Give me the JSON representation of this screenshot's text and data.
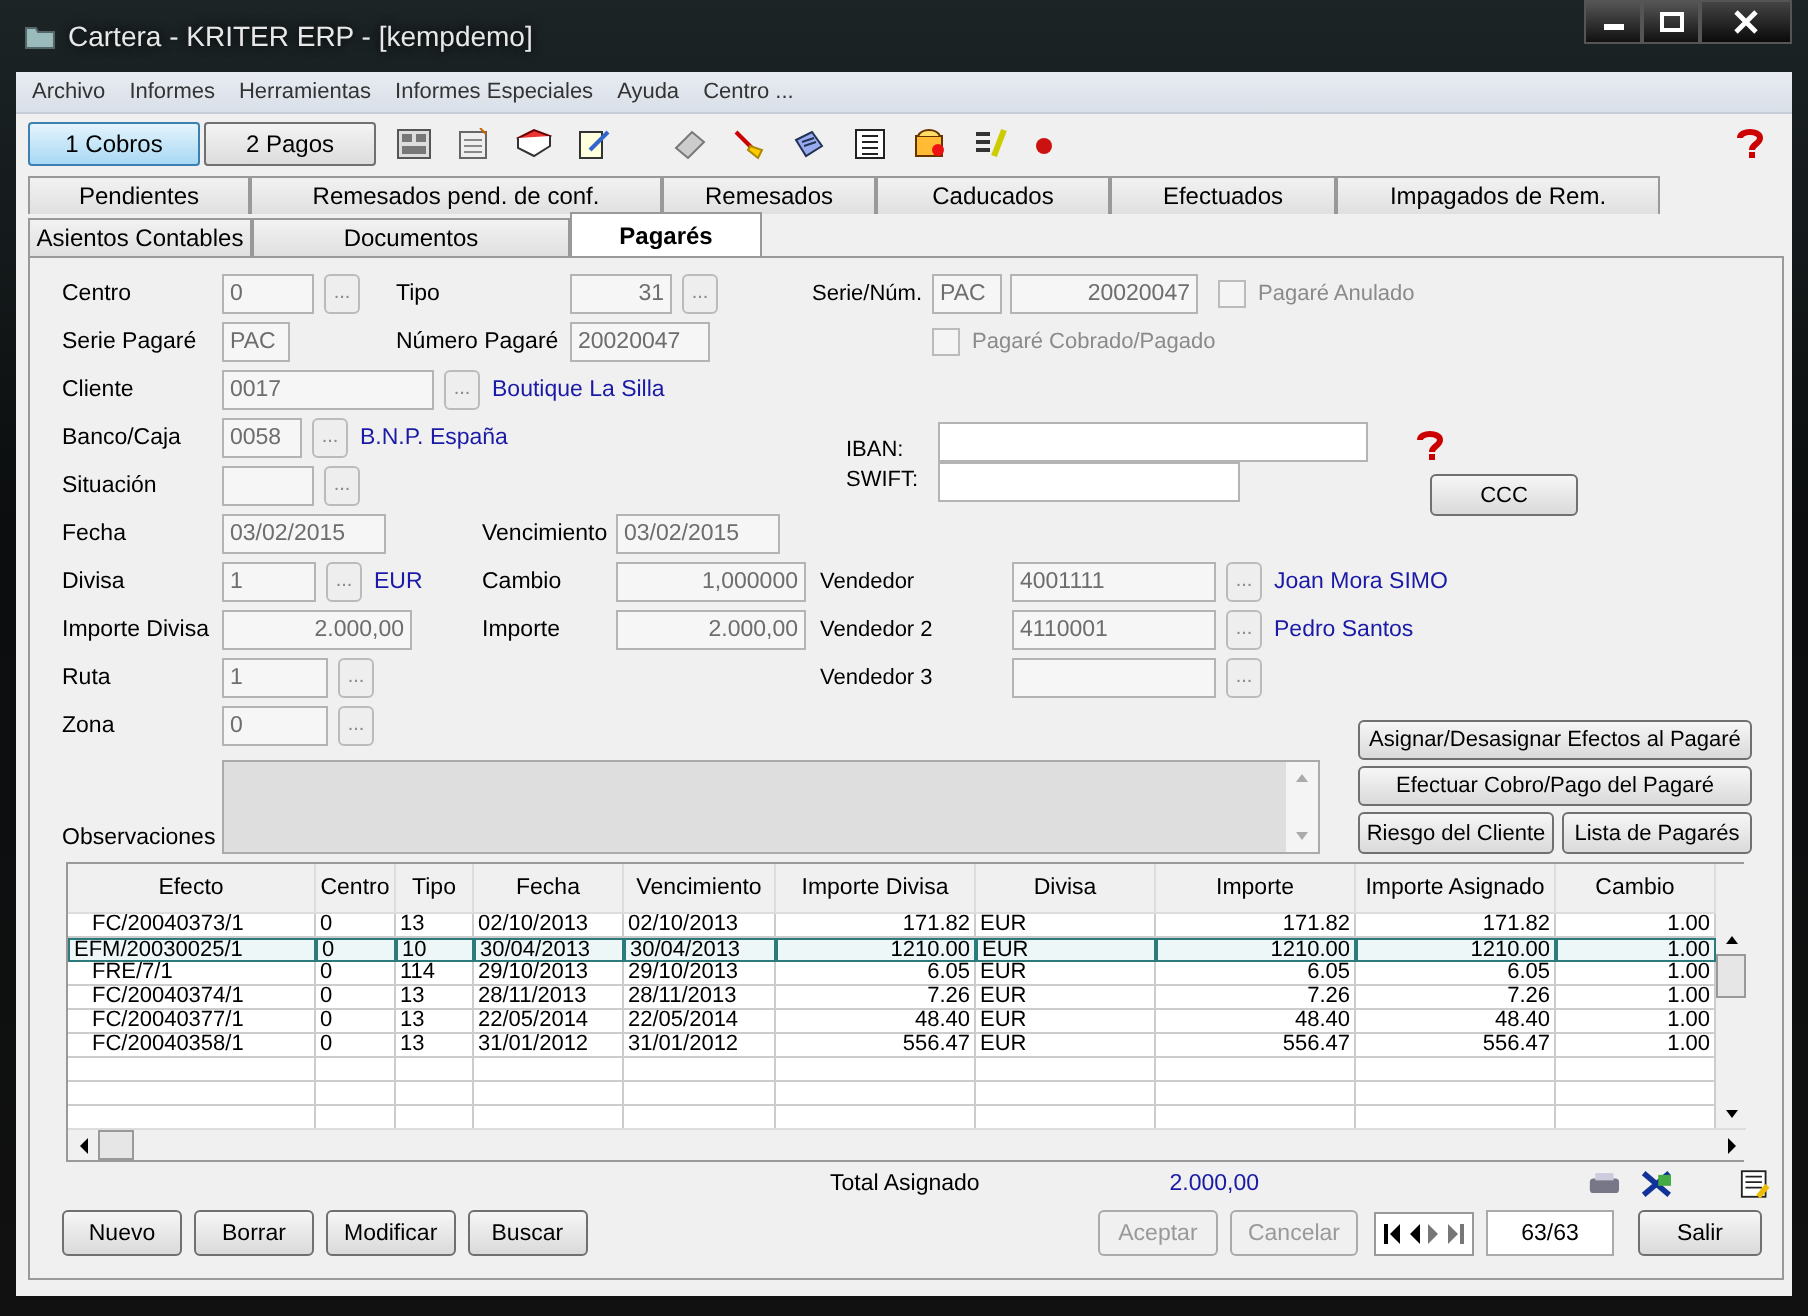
{
  "window": {
    "title": "Cartera - KRITER ERP - [kempdemo]"
  },
  "menu": [
    "Archivo",
    "Informes",
    "Herramientas",
    "Informes Especiales",
    "Ayuda",
    "Centro ..."
  ],
  "mode_buttons": [
    {
      "label": "1 Cobros",
      "selected": true
    },
    {
      "label": "2 Pagos",
      "selected": false
    }
  ],
  "tabs_row1": [
    {
      "label": "Pendientes",
      "selected": false
    },
    {
      "label": "Remesados pend. de conf.",
      "selected": false
    },
    {
      "label": "Remesados",
      "selected": false
    },
    {
      "label": "Caducados",
      "selected": false
    },
    {
      "label": "Efectuados",
      "selected": false
    },
    {
      "label": "Impagados de Rem.",
      "selected": false
    }
  ],
  "tabs_row2": [
    {
      "label": "Asientos Contables",
      "selected": false
    },
    {
      "label": "Documentos",
      "selected": false
    },
    {
      "label": "Pagarés",
      "selected": true
    }
  ],
  "form": {
    "rows": [
      {
        "label": "Centro",
        "value": "0",
        "lookup": "...",
        "second": {
          "label": "Tipo",
          "value": "31",
          "numeric": true,
          "lookup": "..."
        }
      },
      {
        "label": "Serie Pagaré",
        "value": "PAC",
        "second": {
          "label": "Número Pagaré",
          "value": "20020047"
        }
      },
      {
        "label": "Cliente",
        "value": "0017",
        "lookup": "...",
        "link": "Boutique La Silla"
      },
      {
        "label": "Banco/Caja",
        "value": "0058",
        "lookup": "...",
        "link": "B.N.P. España"
      },
      {
        "label": "Situación",
        "lookup": "..."
      },
      {
        "label": "Fecha",
        "value": "03/02/2015",
        "second": {
          "label": "Vencimiento",
          "value": "03/02/2015"
        }
      },
      {
        "label": "Divisa",
        "value": "1",
        "lookup": "...",
        "link": "EUR",
        "second": {
          "label": "Cambio",
          "value": "1,000000",
          "numeric": true
        }
      },
      {
        "label": "Importe Divisa",
        "value": "2.000,00",
        "numeric": true,
        "second": {
          "label": "Importe",
          "value": "2.000,00",
          "numeric": true
        }
      },
      {
        "label": "Ruta",
        "value": "1",
        "lookup": "..."
      },
      {
        "label": "Zona",
        "value": "0",
        "lookup": "..."
      }
    ],
    "serie_num": {
      "label": "Serie/Núm.",
      "serie": "PAC",
      "numero": "20020047"
    },
    "checkboxes": [
      {
        "label": "Pagaré Anulado",
        "checked": false,
        "disabled": true
      },
      {
        "label": "Pagaré Cobrado/Pagado",
        "checked": false,
        "disabled": true
      }
    ],
    "iban": {
      "label": "IBAN:"
    },
    "swift": {
      "label": "SWIFT:"
    },
    "ccc_button": "CCC",
    "vendedores": [
      {
        "label": "Vendedor",
        "value": "4001111",
        "lookup": "...",
        "link": "Joan Mora SIMO"
      },
      {
        "label": "Vendedor 2",
        "value": "4110001",
        "lookup": "...",
        "link": "Pedro Santos"
      },
      {
        "label": "Vendedor 3",
        "lookup": "..."
      }
    ],
    "action_buttons": [
      "Asignar/Desasignar Efectos al Pagaré",
      "Efectuar Cobro/Pago del Pagaré",
      "Riesgo del Cliente",
      "Lista de Pagarés"
    ],
    "observaciones": {
      "label": "Observaciones"
    }
  },
  "table": {
    "columns": [
      "Efecto",
      "Centro",
      "Tipo",
      "Fecha",
      "Vencimiento",
      "Importe Divisa",
      "Divisa",
      "Importe",
      "Importe Asignado",
      "Cambio"
    ],
    "rows": [
      {
        "cells": [
          "FC/20040373/1",
          "0",
          "13",
          "02/10/2013",
          "02/10/2013",
          "171.82",
          "EUR",
          "171.82",
          "171.82",
          "1.00"
        ],
        "selected": false
      },
      {
        "cells": [
          "EFM/20030025/1",
          "0",
          "10",
          "30/04/2013",
          "30/04/2013",
          "1210.00",
          "EUR",
          "1210.00",
          "1210.00",
          "1.00"
        ],
        "selected": true
      },
      {
        "cells": [
          "FRE/7/1",
          "0",
          "114",
          "29/10/2013",
          "29/10/2013",
          "6.05",
          "EUR",
          "6.05",
          "6.05",
          "1.00"
        ],
        "selected": false
      },
      {
        "cells": [
          "FC/20040374/1",
          "0",
          "13",
          "28/11/2013",
          "28/11/2013",
          "7.26",
          "EUR",
          "7.26",
          "7.26",
          "1.00"
        ],
        "selected": false
      },
      {
        "cells": [
          "FC/20040377/1",
          "0",
          "13",
          "22/05/2014",
          "22/05/2014",
          "48.40",
          "EUR",
          "48.40",
          "48.40",
          "1.00"
        ],
        "selected": false
      },
      {
        "cells": [
          "FC/20040358/1",
          "0",
          "13",
          "31/01/2012",
          "31/01/2012",
          "556.47",
          "EUR",
          "556.47",
          "556.47",
          "1.00"
        ],
        "selected": false
      }
    ]
  },
  "total": {
    "label": "Total Asignado",
    "value": "2.000,00"
  },
  "left_buttons": [
    {
      "label": "Nuevo",
      "disabled": false
    },
    {
      "label": "Borrar",
      "disabled": false
    },
    {
      "label": "Modificar",
      "disabled": false
    },
    {
      "label": "Buscar",
      "disabled": false
    }
  ],
  "right_buttons": [
    {
      "label": "Aceptar",
      "disabled": true
    },
    {
      "label": "Cancelar",
      "disabled": true
    }
  ],
  "record": "63/63",
  "exit_button": "Salir"
}
